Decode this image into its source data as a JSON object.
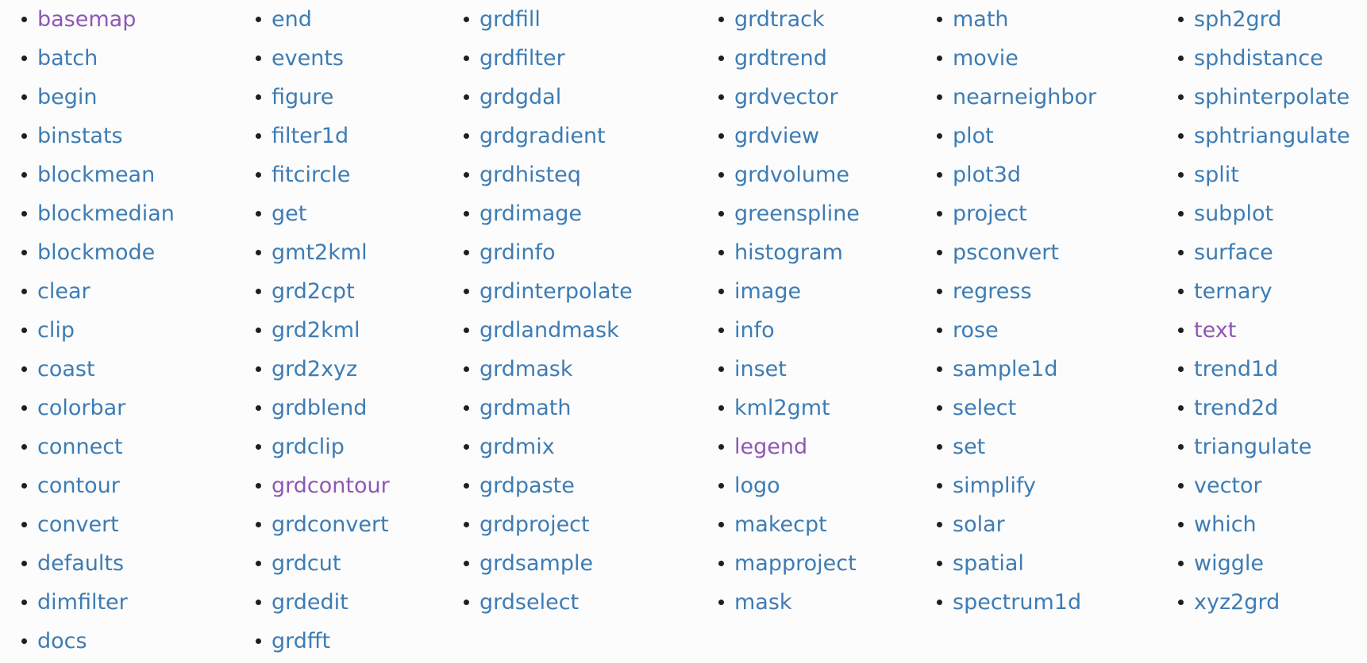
{
  "columns": [
    {
      "items": [
        {
          "label": "basemap",
          "visited": true
        },
        {
          "label": "batch"
        },
        {
          "label": "begin"
        },
        {
          "label": "binstats"
        },
        {
          "label": "blockmean"
        },
        {
          "label": "blockmedian"
        },
        {
          "label": "blockmode"
        },
        {
          "label": "clear"
        },
        {
          "label": "clip"
        },
        {
          "label": "coast"
        },
        {
          "label": "colorbar"
        },
        {
          "label": "connect"
        },
        {
          "label": "contour"
        },
        {
          "label": "convert"
        },
        {
          "label": "defaults"
        },
        {
          "label": "dimfilter"
        },
        {
          "label": "docs"
        }
      ]
    },
    {
      "items": [
        {
          "label": "end"
        },
        {
          "label": "events"
        },
        {
          "label": "figure"
        },
        {
          "label": "filter1d"
        },
        {
          "label": "fitcircle"
        },
        {
          "label": "get"
        },
        {
          "label": "gmt2kml"
        },
        {
          "label": "grd2cpt"
        },
        {
          "label": "grd2kml"
        },
        {
          "label": "grd2xyz"
        },
        {
          "label": "grdblend"
        },
        {
          "label": "grdclip"
        },
        {
          "label": "grdcontour",
          "visited": true
        },
        {
          "label": "grdconvert"
        },
        {
          "label": "grdcut"
        },
        {
          "label": "grdedit"
        },
        {
          "label": "grdfft"
        }
      ]
    },
    {
      "items": [
        {
          "label": "grdfill"
        },
        {
          "label": "grdfilter"
        },
        {
          "label": "grdgdal"
        },
        {
          "label": "grdgradient"
        },
        {
          "label": "grdhisteq"
        },
        {
          "label": "grdimage"
        },
        {
          "label": "grdinfo"
        },
        {
          "label": "grdinterpolate"
        },
        {
          "label": "grdlandmask"
        },
        {
          "label": "grdmask"
        },
        {
          "label": "grdmath"
        },
        {
          "label": "grdmix"
        },
        {
          "label": "grdpaste"
        },
        {
          "label": "grdproject"
        },
        {
          "label": "grdsample"
        },
        {
          "label": "grdselect"
        }
      ]
    },
    {
      "items": [
        {
          "label": "grdtrack"
        },
        {
          "label": "grdtrend"
        },
        {
          "label": "grdvector"
        },
        {
          "label": "grdview"
        },
        {
          "label": "grdvolume"
        },
        {
          "label": "greenspline"
        },
        {
          "label": "histogram"
        },
        {
          "label": "image"
        },
        {
          "label": "info"
        },
        {
          "label": "inset"
        },
        {
          "label": "kml2gmt"
        },
        {
          "label": "legend",
          "visited": true
        },
        {
          "label": "logo"
        },
        {
          "label": "makecpt"
        },
        {
          "label": "mapproject"
        },
        {
          "label": "mask"
        }
      ]
    },
    {
      "items": [
        {
          "label": "math"
        },
        {
          "label": "movie"
        },
        {
          "label": "nearneighbor"
        },
        {
          "label": "plot"
        },
        {
          "label": "plot3d"
        },
        {
          "label": "project"
        },
        {
          "label": "psconvert"
        },
        {
          "label": "regress"
        },
        {
          "label": "rose"
        },
        {
          "label": "sample1d"
        },
        {
          "label": "select"
        },
        {
          "label": "set"
        },
        {
          "label": "simplify"
        },
        {
          "label": "solar"
        },
        {
          "label": "spatial"
        },
        {
          "label": "spectrum1d"
        }
      ]
    },
    {
      "items": [
        {
          "label": "sph2grd"
        },
        {
          "label": "sphdistance"
        },
        {
          "label": "sphinterpolate"
        },
        {
          "label": "sphtriangulate"
        },
        {
          "label": "split"
        },
        {
          "label": "subplot"
        },
        {
          "label": "surface"
        },
        {
          "label": "ternary"
        },
        {
          "label": "text",
          "visited": true
        },
        {
          "label": "trend1d"
        },
        {
          "label": "trend2d"
        },
        {
          "label": "triangulate"
        },
        {
          "label": "vector"
        },
        {
          "label": "which"
        },
        {
          "label": "wiggle"
        },
        {
          "label": "xyz2grd"
        }
      ]
    }
  ],
  "colors": {
    "link": "#3d7cb4",
    "visited_link": "#8f57b5",
    "bullet": "#1f1f1f",
    "background": "#fcfcfc"
  }
}
